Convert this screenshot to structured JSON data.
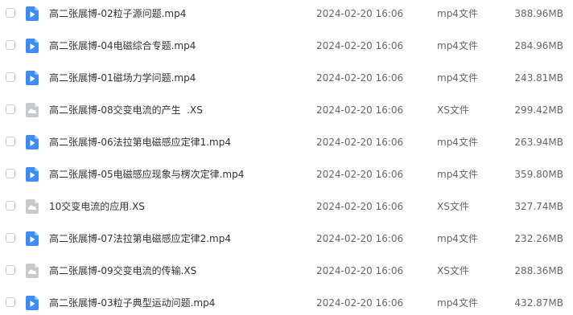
{
  "colors": {
    "video_icon": "#3b8cf5",
    "cloud_icon": "#c5c9d0",
    "text": "#333333",
    "meta_text": "#666666"
  },
  "files": [
    {
      "name": "高二张展博-02粒子源问题.mp4",
      "date": "2024-02-20 16:06",
      "type": "mp4文件",
      "size": "388.96MB",
      "icon": "video-file-icon"
    },
    {
      "name": "高二张展博-04电磁综合专题.mp4",
      "date": "2024-02-20 16:06",
      "type": "mp4文件",
      "size": "284.96MB",
      "icon": "video-file-icon"
    },
    {
      "name": "高二张展博-01磁场力学问题.mp4",
      "date": "2024-02-20 16:06",
      "type": "mp4文件",
      "size": "243.81MB",
      "icon": "video-file-icon"
    },
    {
      "name": "高二张展博-08交变电流的产生  .XS",
      "date": "2024-02-20 16:06",
      "type": "XS文件",
      "size": "299.42MB",
      "icon": "cloud-file-icon"
    },
    {
      "name": "高二张展博-06法拉第电磁感应定律1.mp4",
      "date": "2024-02-20 16:06",
      "type": "mp4文件",
      "size": "263.94MB",
      "icon": "video-file-icon"
    },
    {
      "name": "高二张展博-05电磁感应现象与楞次定律.mp4",
      "date": "2024-02-20 16:06",
      "type": "mp4文件",
      "size": "359.80MB",
      "icon": "video-file-icon"
    },
    {
      "name": "10交变电流的应用.XS",
      "date": "2024-02-20 16:06",
      "type": "XS文件",
      "size": "327.74MB",
      "icon": "cloud-file-icon"
    },
    {
      "name": "高二张展博-07法拉第电磁感应定律2.mp4",
      "date": "2024-02-20 16:06",
      "type": "mp4文件",
      "size": "232.26MB",
      "icon": "video-file-icon"
    },
    {
      "name": "高二张展博-09交变电流的传输.XS",
      "date": "2024-02-20 16:06",
      "type": "XS文件",
      "size": "288.36MB",
      "icon": "cloud-file-icon"
    },
    {
      "name": "高二张展博-03粒子典型运动问题.mp4",
      "date": "2024-02-20 16:06",
      "type": "mp4文件",
      "size": "432.87MB",
      "icon": "video-file-icon"
    }
  ]
}
